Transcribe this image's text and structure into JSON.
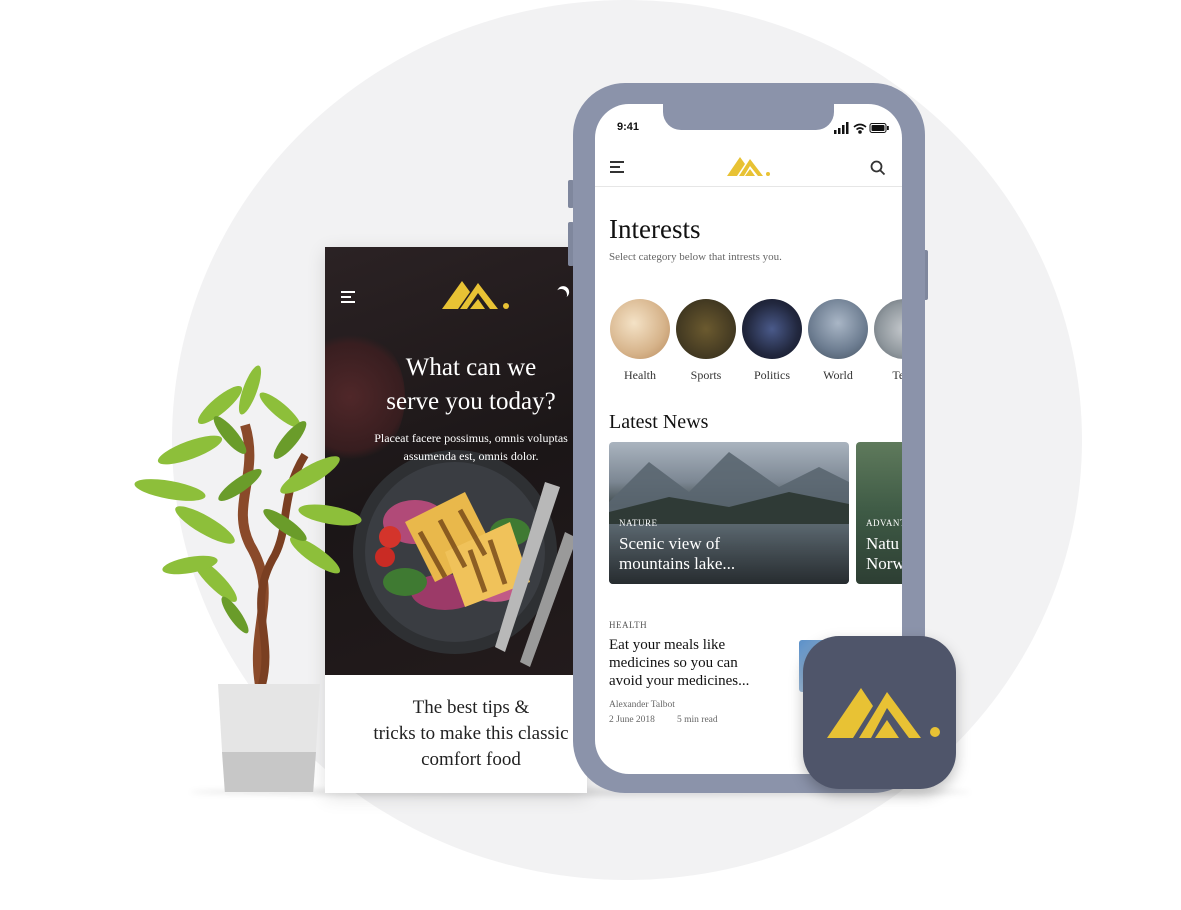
{
  "colors": {
    "accent_gold": "#e8c234",
    "frame": "#8b93aa",
    "icon_bg": "#4f556a"
  },
  "back_phone": {
    "hero_title_line1": "What can we",
    "hero_title_line2": "serve you today?",
    "hero_sub_line1": "Placeat facere possimus, omnis voluptas",
    "hero_sub_line2": "assumenda est, omnis dolor.",
    "bottom_line1": "The best tips &",
    "bottom_line2": "tricks to make this classic",
    "bottom_line3": "comfort food",
    "icons": [
      "menu-icon",
      "logo-icon",
      "moon-icon"
    ]
  },
  "status_bar": {
    "time": "9:41",
    "icons": [
      "signal-icon",
      "wifi-icon",
      "battery-icon"
    ]
  },
  "header": {
    "icons": [
      "menu-icon",
      "logo-icon",
      "search-icon"
    ]
  },
  "interests": {
    "title": "Interests",
    "subtitle": "Select category below that intrests you.",
    "categories": [
      {
        "label": "Health"
      },
      {
        "label": "Sports"
      },
      {
        "label": "Politics"
      },
      {
        "label": "World"
      },
      {
        "label": "Tech"
      }
    ]
  },
  "latest": {
    "title": "Latest News",
    "cards": [
      {
        "tag": "NATURE",
        "title_line1": "Scenic view of",
        "title_line2": "mountains lake..."
      },
      {
        "tag": "ADVANT",
        "title_line1": "Natu",
        "title_line2": "Norw"
      }
    ]
  },
  "article": {
    "tag": "HEALTH",
    "title_line1": "Eat your meals like",
    "title_line2": "medicines so you can",
    "title_line3": "avoid your medicines...",
    "author": "Alexander Talbot",
    "date": "2 June 2018",
    "read_time": "5 min read"
  }
}
